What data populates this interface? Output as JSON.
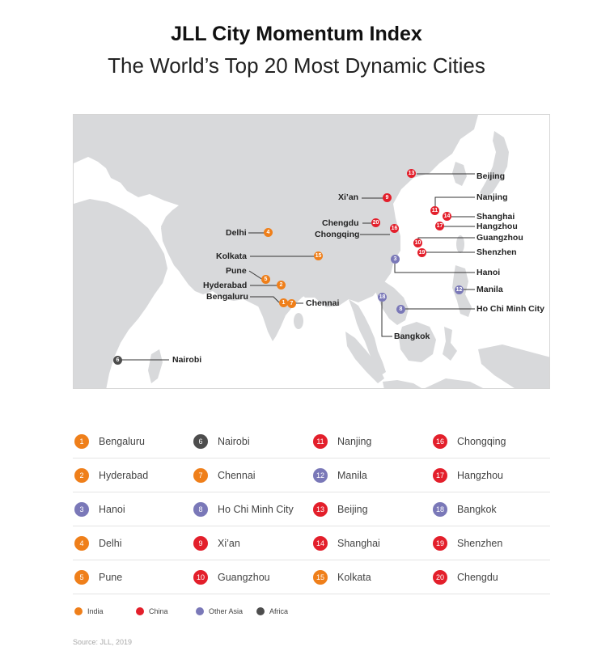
{
  "header": {
    "title": "JLL City Momentum Index",
    "subtitle": "The World’s Top 20 Most Dynamic Cities"
  },
  "colors": {
    "india": "#ef7f1a",
    "china": "#e31f2b",
    "other_asia": "#7a78b8",
    "africa": "#4d4d4d",
    "land": "#d8d9db",
    "leader": "#333333"
  },
  "map": {
    "labels": {
      "beijing": "Beijing",
      "xian": "Xi’an",
      "nanjing": "Nanjing",
      "shanghai": "Shanghai",
      "chengdu": "Chengdu",
      "hangzhou": "Hangzhou",
      "chongqing": "Chongqing",
      "guangzhou": "Guangzhou",
      "delhi": "Delhi",
      "kolkata": "Kolkata",
      "shenzhen": "Shenzhen",
      "pune": "Pune",
      "hanoi": "Hanoi",
      "hyderabad": "Hyderabad",
      "manila": "Manila",
      "bengaluru": "Bengaluru",
      "chennai": "Chennai",
      "hcmc": "Ho Chi Minh City",
      "bangkok": "Bangkok",
      "nairobi": "Nairobi"
    },
    "markers": {
      "m1": "1",
      "m2": "2",
      "m3": "3",
      "m4": "4",
      "m5": "5",
      "m6": "6",
      "m7": "7",
      "m8": "8",
      "m9": "9",
      "m10": "10",
      "m11": "11",
      "m12": "12",
      "m13": "13",
      "m14": "14",
      "m15": "15",
      "m16": "16",
      "m17": "17",
      "m18": "18",
      "m19": "19",
      "m20": "20"
    }
  },
  "ranking": [
    [
      {
        "rank": "1",
        "city": "Bengaluru"
      },
      {
        "rank": "6",
        "city": "Nairobi"
      },
      {
        "rank": "11",
        "city": "Nanjing"
      },
      {
        "rank": "16",
        "city": "Chongqing"
      }
    ],
    [
      {
        "rank": "2",
        "city": "Hyderabad"
      },
      {
        "rank": "7",
        "city": "Chennai"
      },
      {
        "rank": "12",
        "city": "Manila"
      },
      {
        "rank": "17",
        "city": "Hangzhou"
      }
    ],
    [
      {
        "rank": "3",
        "city": "Hanoi"
      },
      {
        "rank": "8",
        "city": "Ho Chi Minh City"
      },
      {
        "rank": "13",
        "city": "Beijing"
      },
      {
        "rank": "18",
        "city": "Bangkok"
      }
    ],
    [
      {
        "rank": "4",
        "city": "Delhi"
      },
      {
        "rank": "9",
        "city": "Xi’an"
      },
      {
        "rank": "14",
        "city": "Shanghai"
      },
      {
        "rank": "19",
        "city": "Shenzhen"
      }
    ],
    [
      {
        "rank": "5",
        "city": "Pune"
      },
      {
        "rank": "10",
        "city": "Guangzhou"
      },
      {
        "rank": "15",
        "city": "Kolkata"
      },
      {
        "rank": "20",
        "city": "Chengdu"
      }
    ]
  ],
  "key": [
    {
      "label": "India"
    },
    {
      "label": "China"
    },
    {
      "label": "Other Asia"
    },
    {
      "label": "Africa"
    }
  ],
  "source": "Source: JLL, 2019"
}
